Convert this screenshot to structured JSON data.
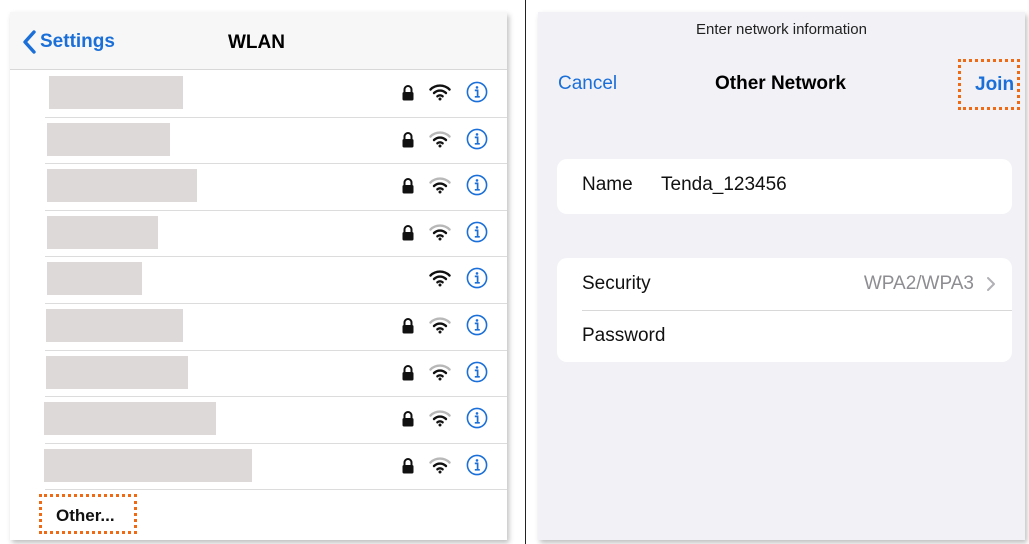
{
  "wlan_screen": {
    "back_label": "Settings",
    "title": "WLAN",
    "networks": [
      {
        "secured": true,
        "signal": "strong"
      },
      {
        "secured": true,
        "signal": "medium"
      },
      {
        "secured": true,
        "signal": "medium"
      },
      {
        "secured": true,
        "signal": "medium"
      },
      {
        "secured": false,
        "signal": "strong"
      },
      {
        "secured": true,
        "signal": "medium"
      },
      {
        "secured": true,
        "signal": "medium"
      },
      {
        "secured": true,
        "signal": "medium"
      },
      {
        "secured": true,
        "signal": "medium"
      }
    ],
    "other_label": "Other..."
  },
  "other_network_screen": {
    "prompt": "Enter network information",
    "cancel_label": "Cancel",
    "title": "Other Network",
    "join_label": "Join",
    "name_label": "Name",
    "name_value": "Tenda_123456",
    "security_label": "Security",
    "security_value": "WPA2/WPA3",
    "password_label": "Password"
  },
  "colors": {
    "accent": "#1a6fd8",
    "highlight": "#f06a14",
    "mask": "#ddd9d9",
    "grouped_background": "#f1f1f6"
  }
}
